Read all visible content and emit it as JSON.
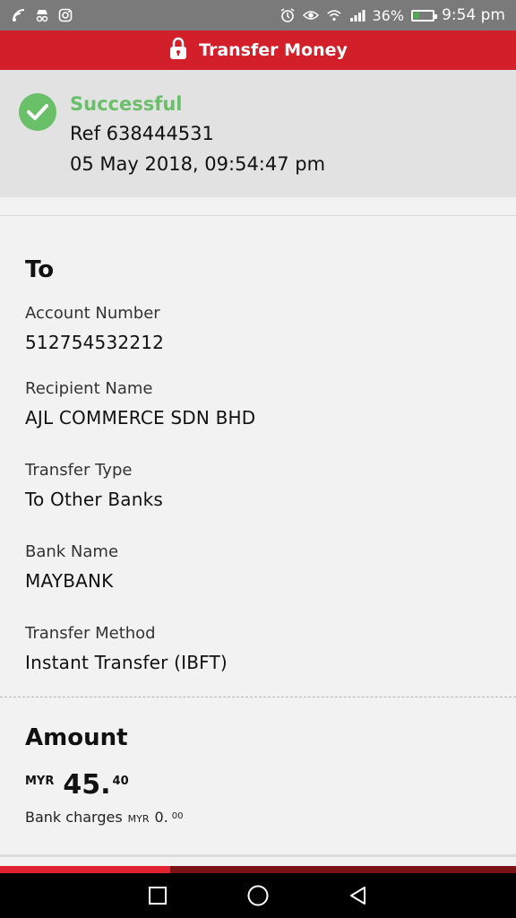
{
  "status_bar": {
    "battery_percent": "36%",
    "time": "9:54 pm",
    "battery_level": 0.36,
    "icons": [
      "wifi-calling-icon",
      "incognito-icon",
      "instagram-icon",
      "alarm-icon",
      "eye-icon",
      "wifi-icon",
      "signal-icon",
      "battery-icon"
    ]
  },
  "header": {
    "title": "Transfer Money",
    "icon": "lock-icon"
  },
  "status": {
    "title": "Successful",
    "ref": "Ref 638444531",
    "datetime": "05 May 2018, 09:54:47 pm",
    "color": "#6abf69"
  },
  "to_section": {
    "title": "To",
    "fields": [
      {
        "label": "Account Number",
        "value": "512754532212"
      },
      {
        "label": "Recipient Name",
        "value": "AJL COMMERCE SDN BHD"
      },
      {
        "label": "Transfer Type",
        "value": "To Other Banks"
      },
      {
        "label": "Bank Name",
        "value": "MAYBANK"
      },
      {
        "label": "Transfer Method",
        "value": "Instant Transfer (IBFT)"
      }
    ]
  },
  "amount_section": {
    "title": "Amount",
    "currency": "MYR",
    "amount_main": "45.",
    "amount_cents": "40",
    "charges_label": "Bank charges",
    "charges_currency": "MYR",
    "charges_main": "0.",
    "charges_cents": "00"
  },
  "progress": {
    "fraction": 0.33,
    "fill_color": "#e0232f",
    "track_color": "#7a1318"
  },
  "nav": {
    "buttons": [
      "recents-button",
      "home-button",
      "back-button"
    ]
  },
  "colors": {
    "brand_red": "#d21f2a",
    "success_green": "#6abf69"
  }
}
